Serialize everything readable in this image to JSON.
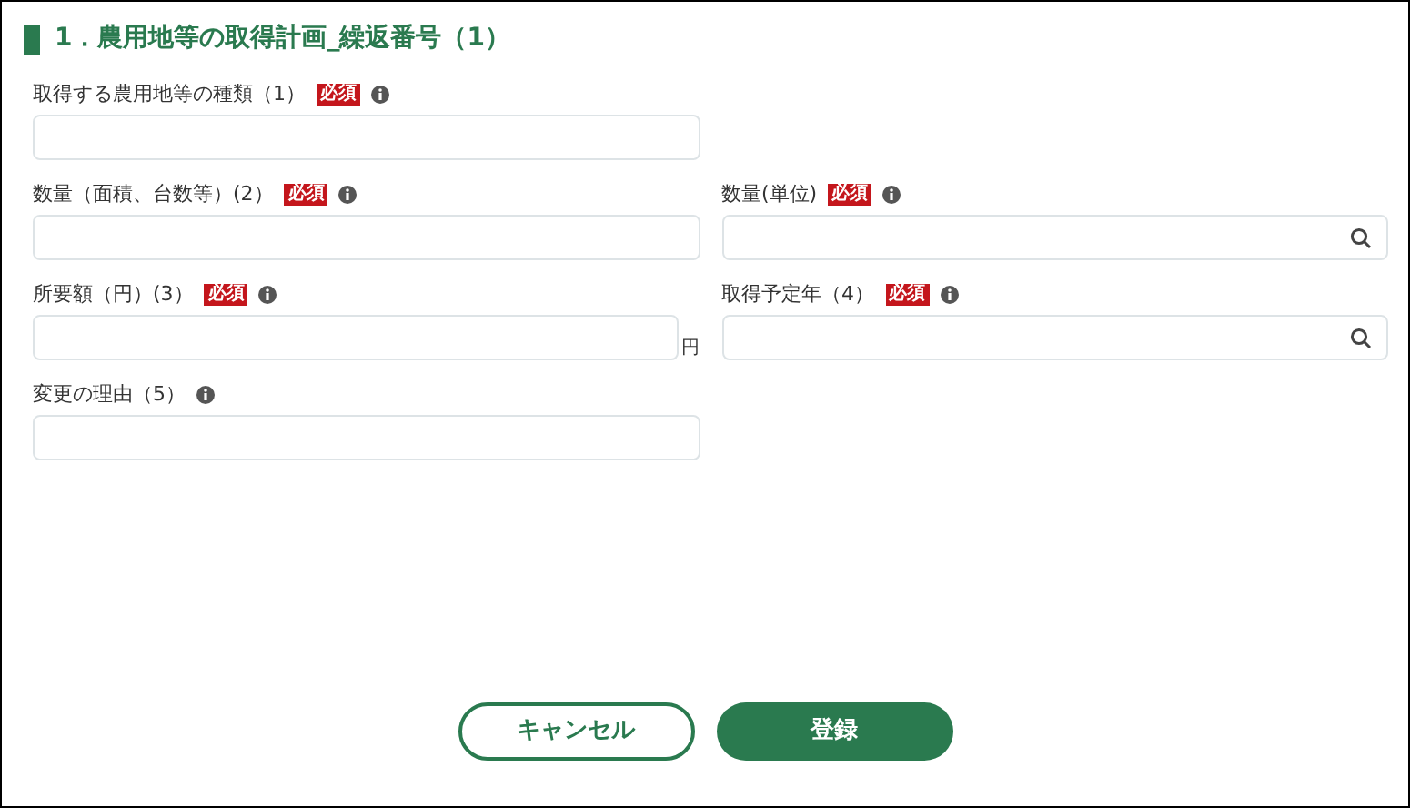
{
  "section": {
    "title": "1．農用地等の取得計画_繰返番号（1）"
  },
  "rows": [
    [
      {
        "label": "取得する農用地等の種類（1）",
        "required": true,
        "required_label": "必須",
        "kind": "text"
      }
    ],
    [
      {
        "label": "数量（面積、台数等）(2）",
        "required": true,
        "required_label": "必須",
        "kind": "text"
      },
      {
        "label": "数量(単位)",
        "required": true,
        "required_label": "必須",
        "kind": "search"
      }
    ],
    [
      {
        "label": "所要額（円）(3）",
        "required": true,
        "required_label": "必須",
        "kind": "unit",
        "suffix": "円"
      },
      {
        "label": "取得予定年（4）",
        "required": true,
        "required_label": "必須",
        "kind": "search"
      }
    ],
    [
      {
        "label": "変更の理由（5）",
        "required": false,
        "kind": "text"
      }
    ]
  ],
  "buttons": [
    {
      "label": "キャンセル",
      "kind": "secondary"
    },
    {
      "label": "登録",
      "kind": "primary"
    }
  ]
}
